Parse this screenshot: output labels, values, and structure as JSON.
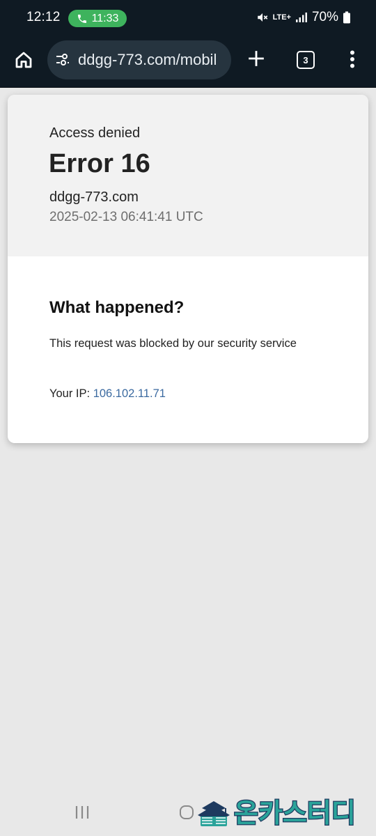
{
  "status_bar": {
    "time": "12:12",
    "call_timer": "11:33",
    "network": "LTE+",
    "battery": "70%"
  },
  "browser": {
    "url": "ddgg-773.com/mobil",
    "tab_count": "3"
  },
  "error_page": {
    "access_denied": "Access denied",
    "error_title": "Error 16",
    "domain": "ddgg-773.com",
    "timestamp": "2025-02-13 06:41:41 UTC",
    "what_happened": "What happened?",
    "description": "This request was blocked by our security service",
    "ip_label": "Your IP: ",
    "ip_value": "106.102.11.71"
  },
  "watermark": {
    "text": "온카스터디"
  },
  "colors": {
    "top_bar": "#0f1a23",
    "url_bar": "#26343f",
    "call_pill": "#3eb35d",
    "ip_link": "#3b6aa0",
    "page_background": "#e8e8e8"
  },
  "icons": {
    "home": "home-icon",
    "site_settings": "tune-icon",
    "new_tab": "plus-icon",
    "menu": "more-vert-icon",
    "call": "phone-icon",
    "mute": "volume-off-icon",
    "signal": "signal-icon",
    "battery": "battery-icon"
  }
}
